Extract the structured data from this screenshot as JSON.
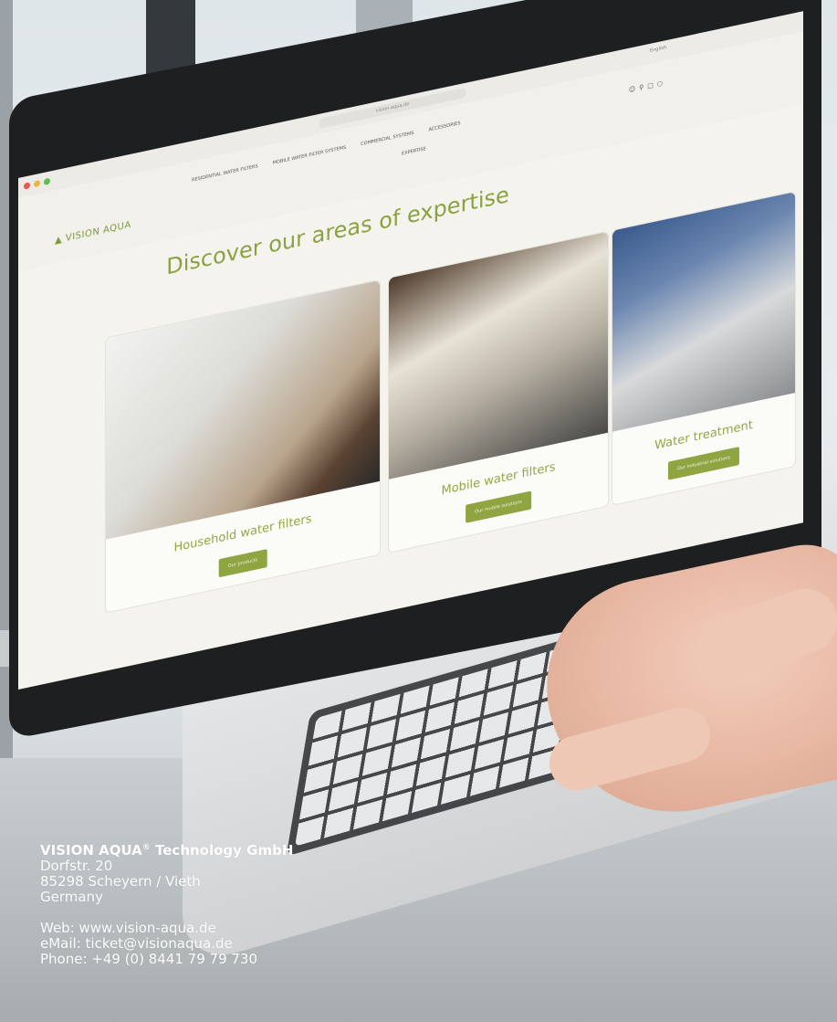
{
  "screen": {
    "topbar": {
      "url": "vision-aqua.de",
      "language": "English"
    },
    "logo": "VISION AQUA",
    "menu": [
      "RESIDENTIAL WATER FILTERS",
      "MOBILE WATER FILTER SYSTEMS",
      "COMMERCIAL SYSTEMS",
      "ACCESSORIES"
    ],
    "menu_second_row": "EXPERTISE",
    "nav_icons": [
      "user-icon",
      "search-icon",
      "cart-icon",
      "menu-icon"
    ],
    "heading": "Discover our areas of expertise",
    "cards": [
      {
        "title": "Household water filters",
        "button": "Our products"
      },
      {
        "title": "Mobile water filters",
        "button": "Our mobile solutions"
      },
      {
        "title": "Water treatment",
        "button": "Our industrial solutions"
      }
    ],
    "accent_color": "#8ea542"
  },
  "footer": {
    "company": "VISION AQUA",
    "company_mark": "®",
    "company_suffix": " Technology GmbH",
    "street": "Dorfstr. 20",
    "city": "85298 Scheyern / Vieth",
    "country": "Germany",
    "web": "Web: www.vision-aqua.de",
    "email": "eMail: ticket@visionaqua.de",
    "phone": "Phone: +49 (0) 8441 79 79 730"
  }
}
